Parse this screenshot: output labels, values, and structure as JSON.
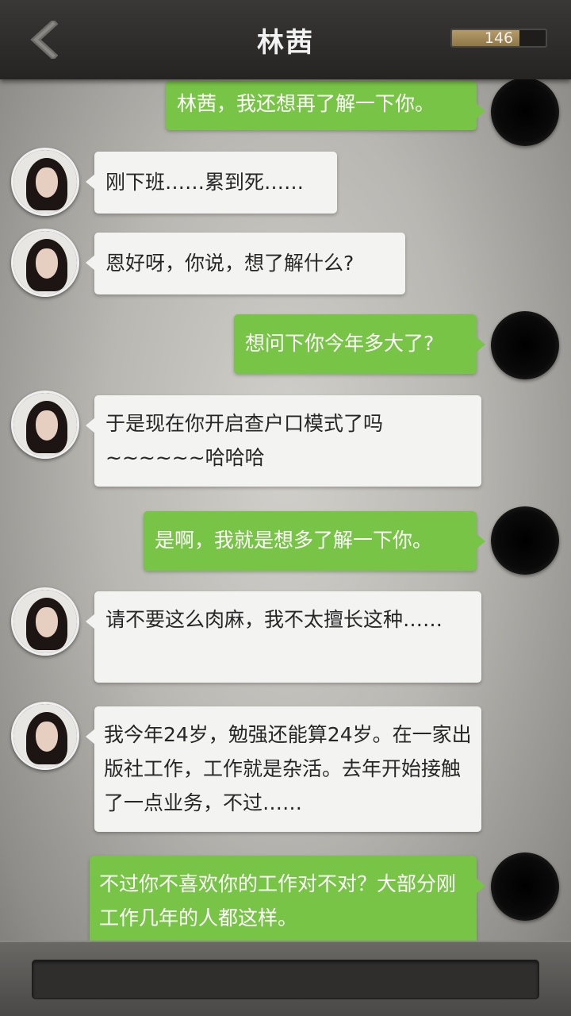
{
  "header": {
    "title": "林茜",
    "back_icon": "chevron-left-icon",
    "progress_value": "146",
    "progress_fill": 0.72
  },
  "messages": [
    {
      "from": "me",
      "text": "林茜，我还想再了解一下你。"
    },
    {
      "from": "her",
      "text": "刚下班……累到死……"
    },
    {
      "from": "her",
      "text": "恩好呀，你说，想了解什么?"
    },
    {
      "from": "me",
      "text": "想问下你今年多大了?"
    },
    {
      "from": "her",
      "text": "于是现在你开启查户口模式了吗~~~~~~哈哈哈"
    },
    {
      "from": "me",
      "text": "是啊，我就是想多了解一下你。"
    },
    {
      "from": "her",
      "text": "请不要这么肉麻，我不太擅长这种……"
    },
    {
      "from": "her",
      "text": "我今年24岁，勉强还能算24岁。在一家出版社工作，工作就是杂活。去年开始接触了一点业务，不过……"
    },
    {
      "from": "me",
      "text": "不过你不喜欢你的工作对不对？大部分刚工作几年的人都这样。"
    }
  ],
  "colors": {
    "me_bubble": "#78c446",
    "her_bubble": "#f3f3f1",
    "header": "#2b2a28"
  }
}
